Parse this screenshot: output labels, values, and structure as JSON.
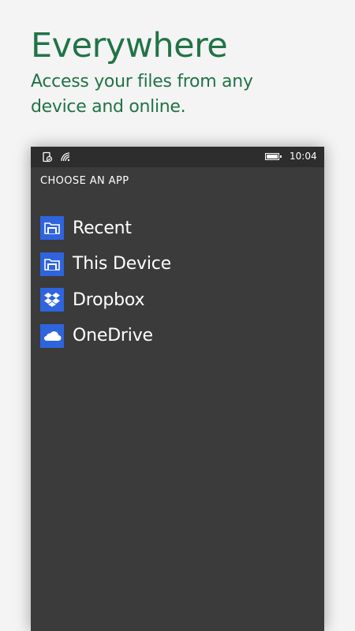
{
  "hero": {
    "title": "Everywhere",
    "subtitle": "Access your files from any device and online."
  },
  "colors": {
    "accent_green": "#217346",
    "panel_bg": "#3b3b3b",
    "status_bg": "#2d2d2d",
    "tile_blue": "#2e64dd"
  },
  "status_bar": {
    "time": "10:04",
    "icons": [
      "location-sync-icon",
      "wifi-icon",
      "battery-icon"
    ]
  },
  "picker": {
    "header": "CHOOSE AN APP",
    "items": [
      {
        "label": "Recent",
        "icon": "folder-icon"
      },
      {
        "label": "This Device",
        "icon": "folder-icon"
      },
      {
        "label": "Dropbox",
        "icon": "dropbox-icon"
      },
      {
        "label": "OneDrive",
        "icon": "onedrive-icon"
      }
    ]
  }
}
